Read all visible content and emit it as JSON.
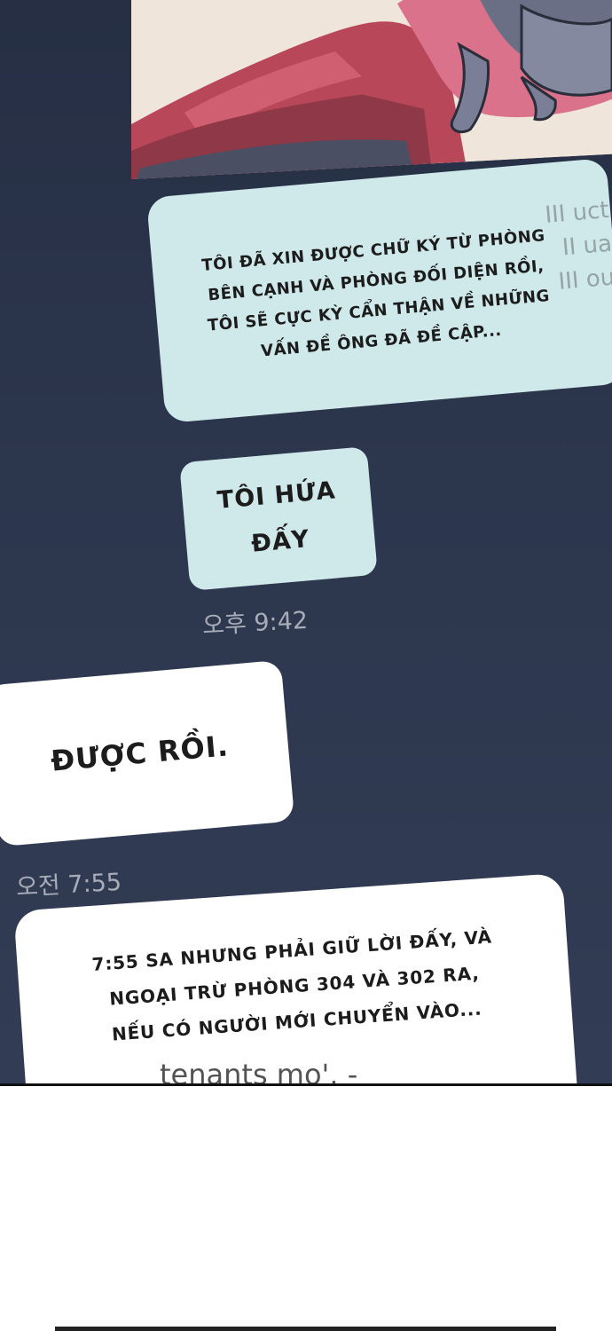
{
  "messages": [
    {
      "id": "msg1",
      "text": "TÔI ĐÃ XIN ĐƯỢC CHỮ KÝ TỪ PHÒNG\nBÊN CẠNH VÀ PHÒNG ĐỐI DIỆN RỒI,\nTÔI SẼ CỰC KỲ CẨN THẬN VỀ NHỮNG\nVẤN ĐỀ ÔNG ĐÃ ĐỀ CẬP..."
    },
    {
      "id": "msg2",
      "text": "TÔI HỨA\nĐẤY"
    },
    {
      "id": "msg3",
      "text": "ĐƯỢC RỒI."
    },
    {
      "id": "msg4",
      "text": "7:55 SA NHƯNG PHẢI GIỮ LỜI ĐẤY, VÀ\nNGOẠI TRỪ PHÒNG 304 VÀ 302 RA,\nNẾU CÓ NGƯỜI MỚI CHUYỂN VÀO..."
    }
  ],
  "timestamps": {
    "t1": "오후 9:42",
    "t2": "오전 7:55"
  },
  "bleed_text": {
    "right": "III uct\nII ua\nIII ou",
    "bottom": "tenants mo'. -"
  },
  "colors": {
    "background": "#2c364d",
    "sent_bubble": "#cfe8ea",
    "received_bubble": "#ffffff",
    "timestamp": "#a7acb8"
  }
}
